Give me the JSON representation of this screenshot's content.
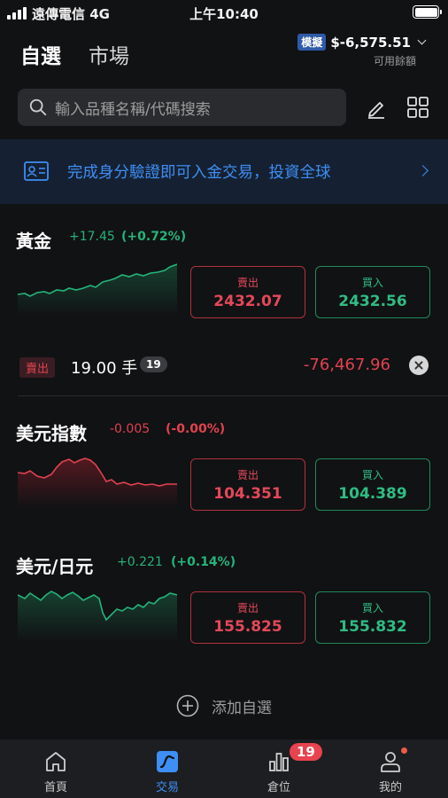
{
  "status": {
    "carrier": "遠傳電信 4G",
    "time": "上午10:40"
  },
  "header": {
    "tab_watchlist": "自選",
    "tab_market": "市場",
    "mode_badge": "模擬",
    "balance": "$-6,575.51",
    "balance_label": "可用餘額"
  },
  "search": {
    "placeholder": "輸入品種名稱/代碼搜索"
  },
  "banner": {
    "text": "完成身分驗證即可入金交易，投資全球"
  },
  "items": [
    {
      "name": "黃金",
      "change": "+17.45",
      "change_pct": "(+0.72%)",
      "sell_label": "賣出",
      "sell_price": "2432.07",
      "buy_label": "買入",
      "buy_price": "2432.56",
      "trend": "up"
    },
    {
      "name": "美元指數",
      "change": "-0.005",
      "change_pct": "(-0.00%)",
      "sell_label": "賣出",
      "sell_price": "104.351",
      "buy_label": "買入",
      "buy_price": "104.389",
      "trend": "down"
    },
    {
      "name": "美元/日元",
      "change": "+0.221",
      "change_pct": "(+0.14%)",
      "sell_label": "賣出",
      "sell_price": "155.825",
      "buy_label": "買入",
      "buy_price": "155.832",
      "trend": "up"
    }
  ],
  "position": {
    "side": "賣出",
    "lots": "19.00 手",
    "count": "19",
    "pnl": "-76,467.96"
  },
  "add_watchlist": "添加自選",
  "tabbar": {
    "home": "首頁",
    "trade": "交易",
    "positions": "倉位",
    "positions_badge": "19",
    "me": "我的"
  },
  "colors": {
    "up": "#25b47a",
    "down": "#e0424f",
    "accent": "#3f8ef5",
    "background": "#111214"
  }
}
